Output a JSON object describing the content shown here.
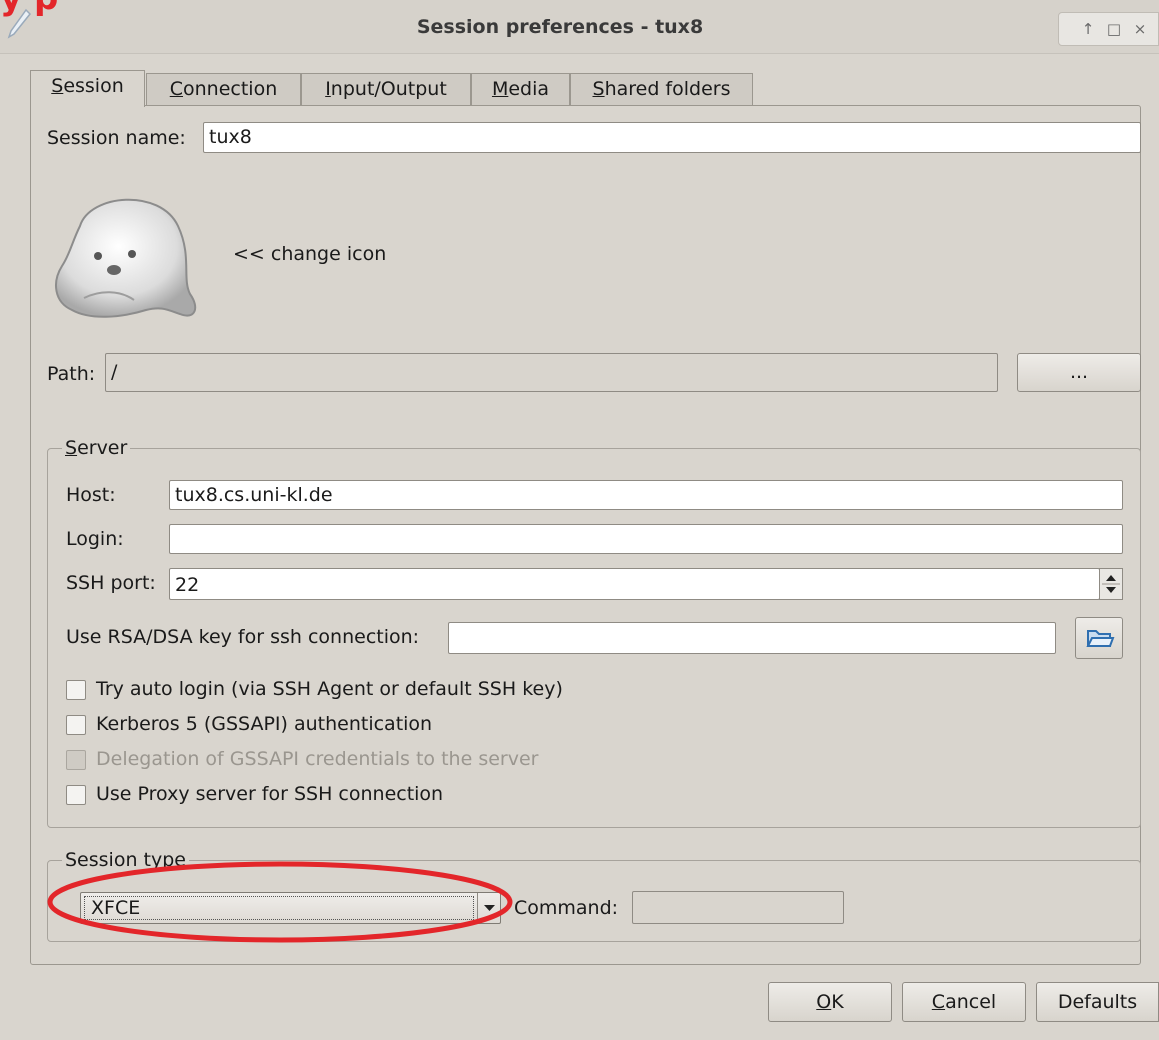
{
  "window": {
    "title": "Session preferences - tux8",
    "overlay_text": "y p",
    "controls": {
      "up": "↑",
      "maximize": "□",
      "close": "×"
    }
  },
  "tabs": [
    {
      "key": "S",
      "rest": "ession"
    },
    {
      "key": "C",
      "rest": "onnection"
    },
    {
      "key": "I",
      "rest": "nput/Output"
    },
    {
      "key": "M",
      "rest": "edia"
    },
    {
      "key": "S",
      "rest": "hared folders"
    }
  ],
  "session": {
    "name_label": "Session name:",
    "name_value": "tux8",
    "change_icon_label": "<< change icon",
    "path_label": "Path:",
    "path_value": "/",
    "browse_label": "..."
  },
  "server": {
    "legend_key": "S",
    "legend_rest": "erver",
    "host_label": "Host:",
    "host_value": "tux8.cs.uni-kl.de",
    "login_label": "Login:",
    "login_value": "",
    "ssh_port_label": "SSH port:",
    "ssh_port_value": "22",
    "rsa_label": "Use RSA/DSA key for ssh connection:",
    "rsa_value": "",
    "checkboxes": [
      {
        "label": "Try auto login (via SSH Agent or default SSH key)",
        "checked": false,
        "enabled": true
      },
      {
        "label": "Kerberos 5 (GSSAPI) authentication",
        "checked": false,
        "enabled": true
      },
      {
        "label": "Delegation of GSSAPI credentials to the server",
        "checked": false,
        "enabled": false
      },
      {
        "label": "Use Proxy server for SSH connection",
        "checked": false,
        "enabled": true
      }
    ]
  },
  "session_type": {
    "legend": "Session type",
    "selected": "XFCE",
    "command_label": "Command:",
    "command_value": ""
  },
  "buttons": {
    "ok_key": "O",
    "ok_rest": "K",
    "cancel_key": "C",
    "cancel_rest": "ancel",
    "defaults": "Defaults"
  },
  "colors": {
    "annotation": "#e3262a",
    "background": "#d9d5ce"
  }
}
